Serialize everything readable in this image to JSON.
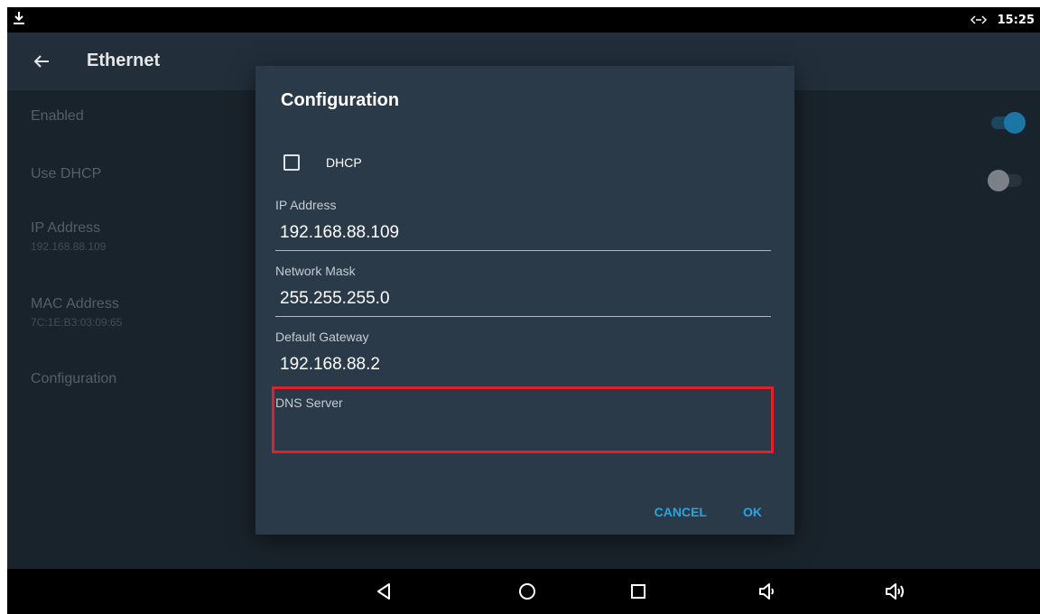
{
  "status_bar": {
    "time": "15:25",
    "download_icon": "download-icon",
    "ethernet_icon": "ethernet-icon"
  },
  "toolbar": {
    "title": "Ethernet",
    "back_icon": "arrow-left-icon"
  },
  "settings": {
    "enabled": {
      "title": "Enabled",
      "toggle_on": true
    },
    "use_dhcp": {
      "title": "Use DHCP",
      "toggle_on": false
    },
    "ip_address": {
      "title": "IP Address",
      "value": "192.168.88.109"
    },
    "mac_address": {
      "title": "MAC Address",
      "value": "7C:1E:B3:03:09:65"
    },
    "configuration": {
      "title": "Configuration"
    }
  },
  "dialog": {
    "title": "Configuration",
    "dhcp": {
      "label": "DHCP",
      "checked": false
    },
    "fields": [
      {
        "label": "IP Address",
        "value": "192.168.88.109"
      },
      {
        "label": "Network Mask",
        "value": "255.255.255.0"
      },
      {
        "label": "Default Gateway",
        "value": "192.168.88.2"
      },
      {
        "label": "DNS Server",
        "value": ""
      }
    ],
    "cancel_label": "CANCEL",
    "ok_label": "OK"
  },
  "colors": {
    "accent": "#2aa3de",
    "highlight": "#e0202a",
    "dialog_bg": "#2a3a49",
    "screen_bg": "#1c2730"
  },
  "navigation": {
    "icons": [
      "back-triangle-icon",
      "home-circle-icon",
      "recents-square-icon",
      "volume-down-icon",
      "volume-up-icon"
    ]
  }
}
